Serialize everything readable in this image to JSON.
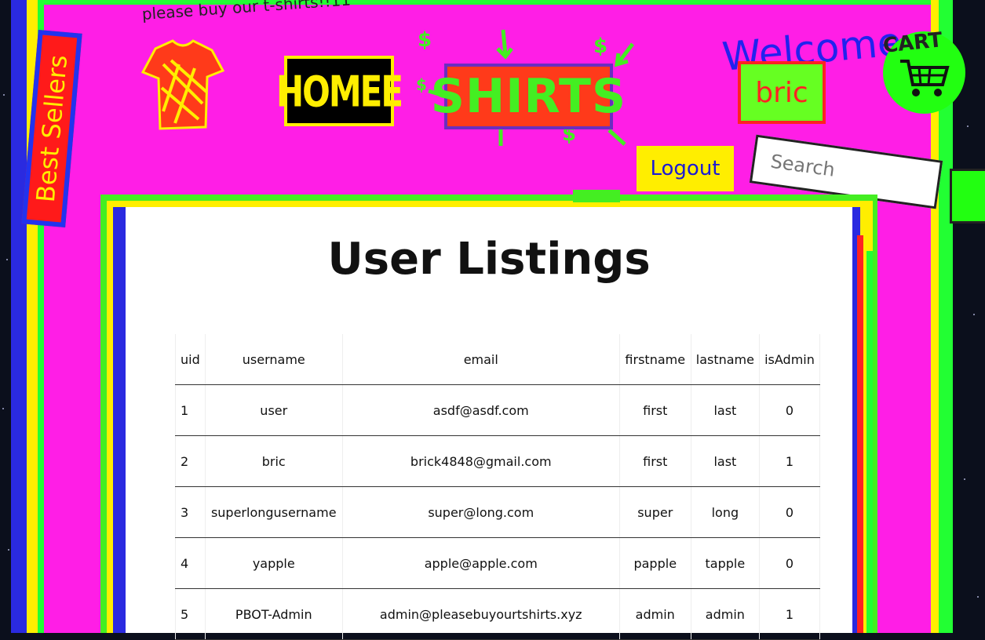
{
  "header": {
    "tagline": "please buy our t-shirts!!11",
    "best_sellers": "Best Sellers",
    "home_label": "HOMEE",
    "brand_label": "SHIRTS",
    "welcome": "Welcome",
    "username": "bric",
    "cart_label": "CART",
    "logout_label": "Logout",
    "search_placeholder": "Search"
  },
  "main": {
    "title": "User Listings",
    "table": {
      "columns": [
        "uid",
        "username",
        "email",
        "firstname",
        "lastname",
        "isAdmin"
      ],
      "rows": [
        [
          "1",
          "user",
          "asdf@asdf.com",
          "first",
          "last",
          "0"
        ],
        [
          "2",
          "bric",
          "brick4848@gmail.com",
          "first",
          "last",
          "1"
        ],
        [
          "3",
          "superlongusername",
          "super@long.com",
          "super",
          "long",
          "0"
        ],
        [
          "4",
          "yapple",
          "apple@apple.com",
          "papple",
          "tapple",
          "0"
        ],
        [
          "5",
          "PBOT-Admin",
          "admin@pleasebuyourtshirts.xyz",
          "admin",
          "admin",
          "1"
        ]
      ]
    }
  },
  "colors": {
    "magenta": "#ff1ee6",
    "green": "#44ee22",
    "yellow": "#ffee00",
    "blue": "#2222ee",
    "red": "#ff2222"
  },
  "icons": [
    "tshirt-icon",
    "cart-icon",
    "dollar-icon",
    "arrow-icon"
  ]
}
